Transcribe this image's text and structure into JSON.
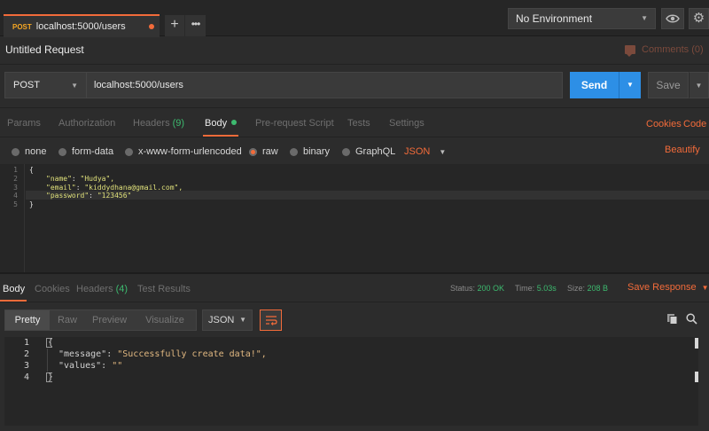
{
  "tabs": {
    "active": {
      "method": "POST",
      "title": "localhost:5000/users"
    },
    "add_label": "+",
    "more_label": "•••"
  },
  "environment": {
    "selected": "No Environment"
  },
  "request": {
    "name": "Untitled Request",
    "comments_label": "Comments (0)",
    "method": "POST",
    "url": "localhost:5000/users",
    "send_label": "Send",
    "save_label": "Save"
  },
  "request_tabs": {
    "params": "Params",
    "authorization": "Authorization",
    "headers": "Headers",
    "headers_count": "(9)",
    "body": "Body",
    "prerequest": "Pre-request Script",
    "tests": "Tests",
    "settings": "Settings",
    "cookies": "Cookies",
    "code": "Code"
  },
  "body_types": {
    "none": "none",
    "form_data": "form-data",
    "urlencoded": "x-www-form-urlencoded",
    "raw": "raw",
    "binary": "binary",
    "graphql": "GraphQL",
    "format": "JSON",
    "beautify": "Beautify"
  },
  "request_body": {
    "lines": [
      "1",
      "2",
      "3",
      "4",
      "5"
    ],
    "code": {
      "l1": "{",
      "l2_key": "\"name\"",
      "l2_val": "\"Hudya\",",
      "l3_key": "\"email\"",
      "l3_val": "\"kiddydhana@gmail.com\",",
      "l4_key": "\"password\"",
      "l4_val": "\"123456\"",
      "l5": "}"
    }
  },
  "response_tabs": {
    "body": "Body",
    "cookies": "Cookies",
    "headers": "Headers",
    "headers_count": "(4)",
    "test_results": "Test Results"
  },
  "response_meta": {
    "status_label": "Status:",
    "status_value": "200 OK",
    "time_label": "Time:",
    "time_value": "5.03s",
    "size_label": "Size:",
    "size_value": "208 B",
    "save_response": "Save Response"
  },
  "response_view": {
    "pretty": "Pretty",
    "raw": "Raw",
    "preview": "Preview",
    "visualize": "Visualize",
    "format": "JSON"
  },
  "response_body": {
    "lines": [
      "1",
      "2",
      "3",
      "4"
    ],
    "code": {
      "l1": "{",
      "l2_key": "\"message\"",
      "l2_val": "\"Successfully create data!\",",
      "l3_key": "\"values\"",
      "l3_val": "\"\"",
      "l4": "}"
    }
  },
  "icons": {
    "eye": "eye-icon",
    "gear": "gear-icon",
    "wrap": "wrap-lines-icon",
    "copy": "copy-icon",
    "search": "search-icon",
    "comments": "comment-icon"
  },
  "colors": {
    "accent": "#f26b3a",
    "send": "#2d8fe6",
    "success": "#3dba6f",
    "method_post": "#f5a623"
  }
}
